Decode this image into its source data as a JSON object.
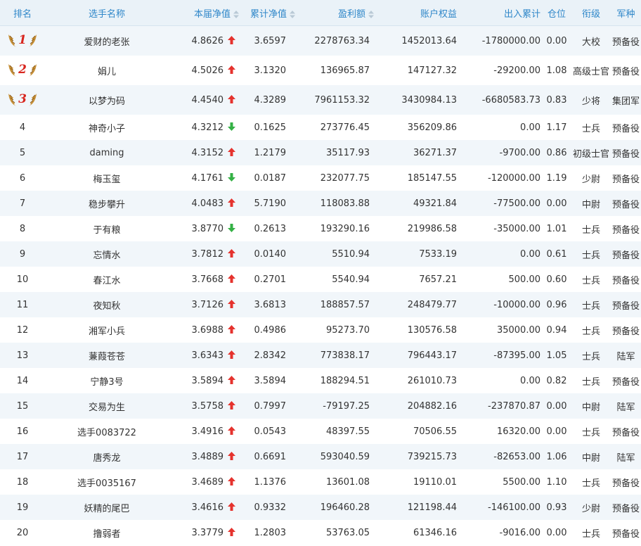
{
  "headers": [
    {
      "label": "排名",
      "sortable": false
    },
    {
      "label": "选手名称",
      "sortable": false
    },
    {
      "label": "本届净值",
      "sortable": true
    },
    {
      "label": "累计净值",
      "sortable": true
    },
    {
      "label": "盈利额",
      "sortable": true
    },
    {
      "label": "账户权益",
      "sortable": false
    },
    {
      "label": "出入累计",
      "sortable": false
    },
    {
      "label": "仓位",
      "sortable": false
    },
    {
      "label": "衔级",
      "sortable": false
    },
    {
      "label": "军种",
      "sortable": false
    }
  ],
  "colors": {
    "header_text": "#2f87c9",
    "header_bg": "#eaf2f8",
    "stripe_bg": "#f1f6fa",
    "up": "#e5322d",
    "down": "#33b044",
    "medal_num": "#d8261f"
  },
  "rows": [
    {
      "rank": "1",
      "name": "爱财的老张",
      "nav": "4.8626",
      "trend": "up",
      "cum_nav": "3.6597",
      "profit": "2278763.34",
      "equity": "1452013.64",
      "flow": "-1780000.00",
      "position": "0.00",
      "title": "大校",
      "branch": "预备役"
    },
    {
      "rank": "2",
      "name": "娟儿",
      "nav": "4.5026",
      "trend": "up",
      "cum_nav": "3.1320",
      "profit": "136965.87",
      "equity": "147127.32",
      "flow": "-29200.00",
      "position": "1.08",
      "title": "高级士官",
      "branch": "预备役"
    },
    {
      "rank": "3",
      "name": "以梦为码",
      "nav": "4.4540",
      "trend": "up",
      "cum_nav": "4.3289",
      "profit": "7961153.32",
      "equity": "3430984.13",
      "flow": "-6680583.73",
      "position": "0.83",
      "title": "少将",
      "branch": "集团军"
    },
    {
      "rank": "4",
      "name": "神奇小子",
      "nav": "4.3212",
      "trend": "down",
      "cum_nav": "0.1625",
      "profit": "273776.45",
      "equity": "356209.86",
      "flow": "0.00",
      "position": "1.17",
      "title": "士兵",
      "branch": "预备役"
    },
    {
      "rank": "5",
      "name": "daming",
      "nav": "4.3152",
      "trend": "up",
      "cum_nav": "1.2179",
      "profit": "35117.93",
      "equity": "36271.37",
      "flow": "-9700.00",
      "position": "0.86",
      "title": "初级士官",
      "branch": "预备役"
    },
    {
      "rank": "6",
      "name": "梅玉玺",
      "nav": "4.1761",
      "trend": "down",
      "cum_nav": "0.0187",
      "profit": "232077.75",
      "equity": "185147.55",
      "flow": "-120000.00",
      "position": "1.19",
      "title": "少尉",
      "branch": "预备役"
    },
    {
      "rank": "7",
      "name": "稳步攀升",
      "nav": "4.0483",
      "trend": "up",
      "cum_nav": "5.7190",
      "profit": "118083.88",
      "equity": "49321.84",
      "flow": "-77500.00",
      "position": "0.00",
      "title": "中尉",
      "branch": "预备役"
    },
    {
      "rank": "8",
      "name": "于有粮",
      "nav": "3.8770",
      "trend": "down",
      "cum_nav": "0.2613",
      "profit": "193290.16",
      "equity": "219986.58",
      "flow": "-35000.00",
      "position": "1.01",
      "title": "士兵",
      "branch": "预备役"
    },
    {
      "rank": "9",
      "name": "忘情水",
      "nav": "3.7812",
      "trend": "up",
      "cum_nav": "0.0140",
      "profit": "5510.94",
      "equity": "7533.19",
      "flow": "0.00",
      "position": "0.61",
      "title": "士兵",
      "branch": "预备役"
    },
    {
      "rank": "10",
      "name": "春江水",
      "nav": "3.7668",
      "trend": "up",
      "cum_nav": "0.2701",
      "profit": "5540.94",
      "equity": "7657.21",
      "flow": "500.00",
      "position": "0.60",
      "title": "士兵",
      "branch": "预备役"
    },
    {
      "rank": "11",
      "name": "夜知秋",
      "nav": "3.7126",
      "trend": "up",
      "cum_nav": "3.6813",
      "profit": "188857.57",
      "equity": "248479.77",
      "flow": "-10000.00",
      "position": "0.96",
      "title": "士兵",
      "branch": "预备役"
    },
    {
      "rank": "12",
      "name": "湘军小兵",
      "nav": "3.6988",
      "trend": "up",
      "cum_nav": "0.4986",
      "profit": "95273.70",
      "equity": "130576.58",
      "flow": "35000.00",
      "position": "0.94",
      "title": "士兵",
      "branch": "预备役"
    },
    {
      "rank": "13",
      "name": "蒹葭苍苍",
      "nav": "3.6343",
      "trend": "up",
      "cum_nav": "2.8342",
      "profit": "773838.17",
      "equity": "796443.17",
      "flow": "-87395.00",
      "position": "1.05",
      "title": "士兵",
      "branch": "陆军"
    },
    {
      "rank": "14",
      "name": "宁静3号",
      "nav": "3.5894",
      "trend": "up",
      "cum_nav": "3.5894",
      "profit": "188294.51",
      "equity": "261010.73",
      "flow": "0.00",
      "position": "0.82",
      "title": "士兵",
      "branch": "预备役"
    },
    {
      "rank": "15",
      "name": "交易为生",
      "nav": "3.5758",
      "trend": "up",
      "cum_nav": "0.7997",
      "profit": "-79197.25",
      "equity": "204882.16",
      "flow": "-237870.87",
      "position": "0.00",
      "title": "中尉",
      "branch": "陆军"
    },
    {
      "rank": "16",
      "name": "选手0083722",
      "nav": "3.4916",
      "trend": "up",
      "cum_nav": "0.0543",
      "profit": "48397.55",
      "equity": "70506.55",
      "flow": "16320.00",
      "position": "0.00",
      "title": "士兵",
      "branch": "预备役"
    },
    {
      "rank": "17",
      "name": "唐秀龙",
      "nav": "3.4889",
      "trend": "up",
      "cum_nav": "0.6691",
      "profit": "593040.59",
      "equity": "739215.73",
      "flow": "-82653.00",
      "position": "1.06",
      "title": "中尉",
      "branch": "陆军"
    },
    {
      "rank": "18",
      "name": "选手0035167",
      "nav": "3.4689",
      "trend": "up",
      "cum_nav": "1.1376",
      "profit": "13601.08",
      "equity": "19110.01",
      "flow": "5500.00",
      "position": "1.10",
      "title": "士兵",
      "branch": "预备役"
    },
    {
      "rank": "19",
      "name": "妖精的尾巴",
      "nav": "3.4616",
      "trend": "up",
      "cum_nav": "0.9332",
      "profit": "196460.28",
      "equity": "121198.44",
      "flow": "-146100.00",
      "position": "0.93",
      "title": "少尉",
      "branch": "预备役"
    },
    {
      "rank": "20",
      "name": "撸弱者",
      "nav": "3.3779",
      "trend": "up",
      "cum_nav": "1.2803",
      "profit": "53763.05",
      "equity": "61346.16",
      "flow": "-9016.00",
      "position": "0.00",
      "title": "士兵",
      "branch": "预备役"
    }
  ]
}
